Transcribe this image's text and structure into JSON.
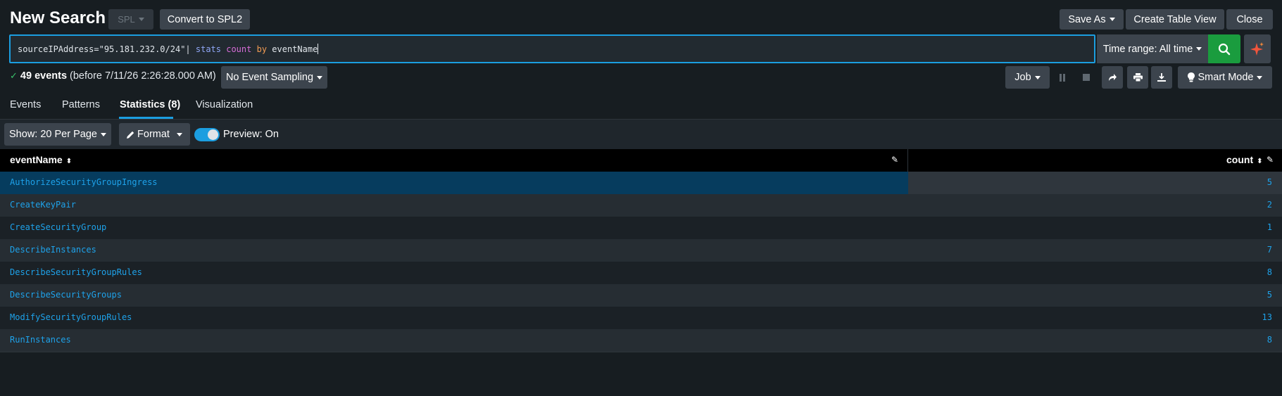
{
  "header": {
    "title": "New Search",
    "spl_label": "SPL",
    "convert_label": "Convert to SPL2",
    "save_as_label": "Save As",
    "create_table_view_label": "Create Table View",
    "close_label": "Close"
  },
  "search": {
    "query_part1": "sourceIPAddress=\"95.181.232.0/24\"| ",
    "query_cmd": "stats",
    "query_space1": " ",
    "query_fn": "count",
    "query_space2": " ",
    "query_by": "by",
    "query_field": " eventName",
    "time_range_label": "Time range: All time"
  },
  "status": {
    "event_count": "49 events",
    "before_text": "(before 7/11/26 2:26:28.000 AM)",
    "sampling_label": "No Event Sampling",
    "job_label": "Job",
    "smart_mode_label": "Smart Mode"
  },
  "tabs": [
    {
      "label": "Events"
    },
    {
      "label": "Patterns"
    },
    {
      "label": "Statistics (8)"
    },
    {
      "label": "Visualization"
    }
  ],
  "controls": {
    "per_page_label": "Show: 20 Per Page",
    "format_label": "Format",
    "preview_label": "Preview: On",
    "preview_on": true
  },
  "table": {
    "columns": [
      "eventName",
      "count"
    ],
    "rows": [
      {
        "eventName": "AuthorizeSecurityGroupIngress",
        "count": "5"
      },
      {
        "eventName": "CreateKeyPair",
        "count": "2"
      },
      {
        "eventName": "CreateSecurityGroup",
        "count": "1"
      },
      {
        "eventName": "DescribeInstances",
        "count": "7"
      },
      {
        "eventName": "DescribeSecurityGroupRules",
        "count": "8"
      },
      {
        "eventName": "DescribeSecurityGroups",
        "count": "5"
      },
      {
        "eventName": "ModifySecurityGroupRules",
        "count": "13"
      },
      {
        "eventName": "RunInstances",
        "count": "8"
      }
    ]
  },
  "icons": {
    "search": "search-icon",
    "ai": "sparkle-icon",
    "check": "check-icon",
    "pause": "pause-icon",
    "stop": "stop-icon",
    "share": "share-icon",
    "print": "print-icon",
    "export": "download-icon",
    "smart_mode": "lightbulb-icon",
    "format": "pencil-icon",
    "sort": "sort-icon",
    "edit_column": "pencil-icon"
  },
  "colors": {
    "accent": "#1b9ee0",
    "search_button": "#1a9c3e",
    "link": "#1ea2ea",
    "selected_row": "#063c5e"
  }
}
